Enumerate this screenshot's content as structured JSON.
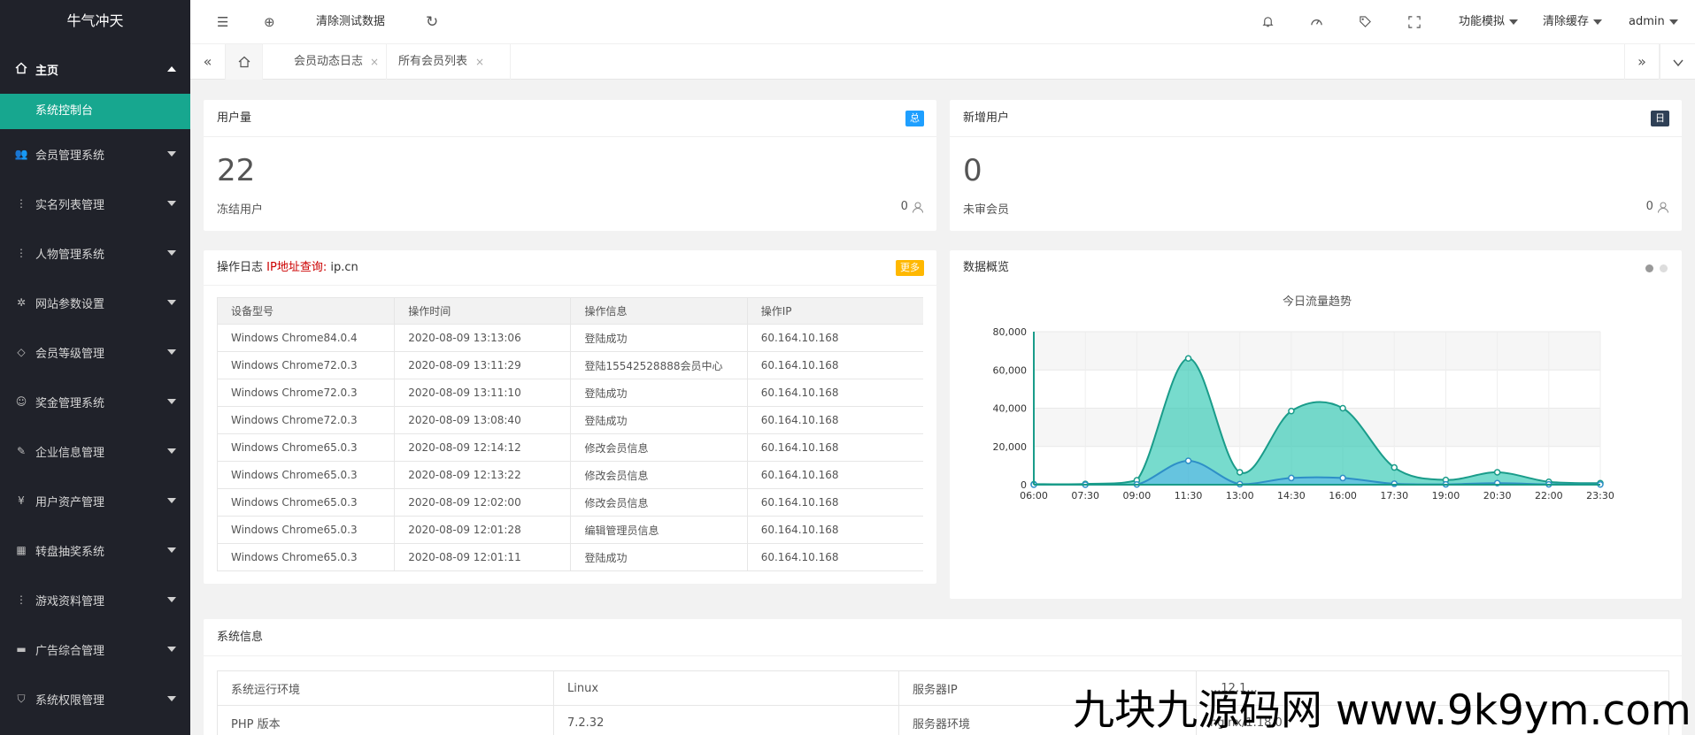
{
  "app": {
    "title": "牛气冲天"
  },
  "sidebar": {
    "home": {
      "label": "主页",
      "icon": "home-icon"
    },
    "home_sub": {
      "label": "系统控制台"
    },
    "items": [
      {
        "label": "会员管理系统",
        "icon": "users-icon"
      },
      {
        "label": "实名列表管理",
        "icon": "dots-icon"
      },
      {
        "label": "人物管理系统",
        "icon": "dots-icon"
      },
      {
        "label": "网站参数设置",
        "icon": "gear-icon"
      },
      {
        "label": "会员等级管理",
        "icon": "diamond-icon"
      },
      {
        "label": "奖金管理系统",
        "icon": "smile-icon"
      },
      {
        "label": "企业信息管理",
        "icon": "edit-icon"
      },
      {
        "label": "用户资产管理",
        "icon": "yen-icon"
      },
      {
        "label": "转盘抽奖系统",
        "icon": "apps-icon"
      },
      {
        "label": "游戏资料管理",
        "icon": "dots-icon"
      },
      {
        "label": "广告综合管理",
        "icon": "monitor-icon"
      },
      {
        "label": "系统权限管理",
        "icon": "shield-icon"
      }
    ]
  },
  "header": {
    "clear_test_data": "清除测试数据",
    "function_sim": "功能模拟",
    "clear_cache": "清除缓存",
    "user": "admin"
  },
  "tabs": {
    "items": [
      {
        "label": "会员动态日志",
        "close": "×"
      },
      {
        "label": "所有会员列表",
        "close": "×"
      }
    ]
  },
  "cards": {
    "users": {
      "title": "用户量",
      "badge": "总",
      "value": "22",
      "sub_label": "冻结用户",
      "sub_value": "0",
      "badge_color": "#1E9FFF"
    },
    "new_users": {
      "title": "新增用户",
      "badge": "日",
      "value": "0",
      "sub_label": "未审会员",
      "sub_value": "0",
      "badge_color": "#2F4056"
    }
  },
  "log": {
    "title": "操作日志",
    "ip_link": "IP地址查询:",
    "ip_site": "ip.cn",
    "more": "更多",
    "columns": [
      "设备型号",
      "操作时间",
      "操作信息",
      "操作IP"
    ],
    "rows": [
      [
        "Windows Chrome84.0.4",
        "2020-08-09 13:13:06",
        "登陆成功",
        "60.164.10.168"
      ],
      [
        "Windows Chrome72.0.3",
        "2020-08-09 13:11:29",
        "登陆15542528888会员中心",
        "60.164.10.168"
      ],
      [
        "Windows Chrome72.0.3",
        "2020-08-09 13:11:10",
        "登陆成功",
        "60.164.10.168"
      ],
      [
        "Windows Chrome72.0.3",
        "2020-08-09 13:08:40",
        "登陆成功",
        "60.164.10.168"
      ],
      [
        "Windows Chrome65.0.3",
        "2020-08-09 12:14:12",
        "修改会员信息",
        "60.164.10.168"
      ],
      [
        "Windows Chrome65.0.3",
        "2020-08-09 12:13:22",
        "修改会员信息",
        "60.164.10.168"
      ],
      [
        "Windows Chrome65.0.3",
        "2020-08-09 12:02:00",
        "修改会员信息",
        "60.164.10.168"
      ],
      [
        "Windows Chrome65.0.3",
        "2020-08-09 12:01:28",
        "编辑管理员信息",
        "60.164.10.168"
      ],
      [
        "Windows Chrome65.0.3",
        "2020-08-09 12:01:11",
        "登陆成功",
        "60.164.10.168"
      ]
    ]
  },
  "overview": {
    "title": "数据概览"
  },
  "chart_data": {
    "type": "area",
    "title": "今日流量趋势",
    "x": [
      "06:00",
      "07:30",
      "09:00",
      "11:30",
      "13:00",
      "14:30",
      "16:00",
      "17:30",
      "19:00",
      "20:30",
      "22:00",
      "23:30"
    ],
    "ylim": [
      0,
      80000
    ],
    "yticks": [
      "0",
      "20,000",
      "40,000",
      "60,000",
      "80,000"
    ],
    "series": [
      {
        "values": [
          300,
          400,
          2300,
          66000,
          6500,
          38500,
          40000,
          9000,
          2500,
          6500,
          1500,
          800
        ],
        "color": "#2ec7b2"
      },
      {
        "values": [
          0,
          0,
          100,
          12500,
          300,
          3500,
          3500,
          500,
          200,
          800,
          200,
          100
        ],
        "color": "#5ab1ef"
      }
    ],
    "grid": true
  },
  "sysinfo": {
    "title": "系统信息",
    "rows": [
      [
        "系统运行环境",
        "Linux",
        "服务器IP",
        "...12.1..."
      ],
      [
        "PHP 版本",
        "7.2.32",
        "服务器环境",
        "nginx/1.18.0"
      ]
    ]
  },
  "watermark": {
    "text": "九块九源码网 www.9k9ym.com"
  }
}
